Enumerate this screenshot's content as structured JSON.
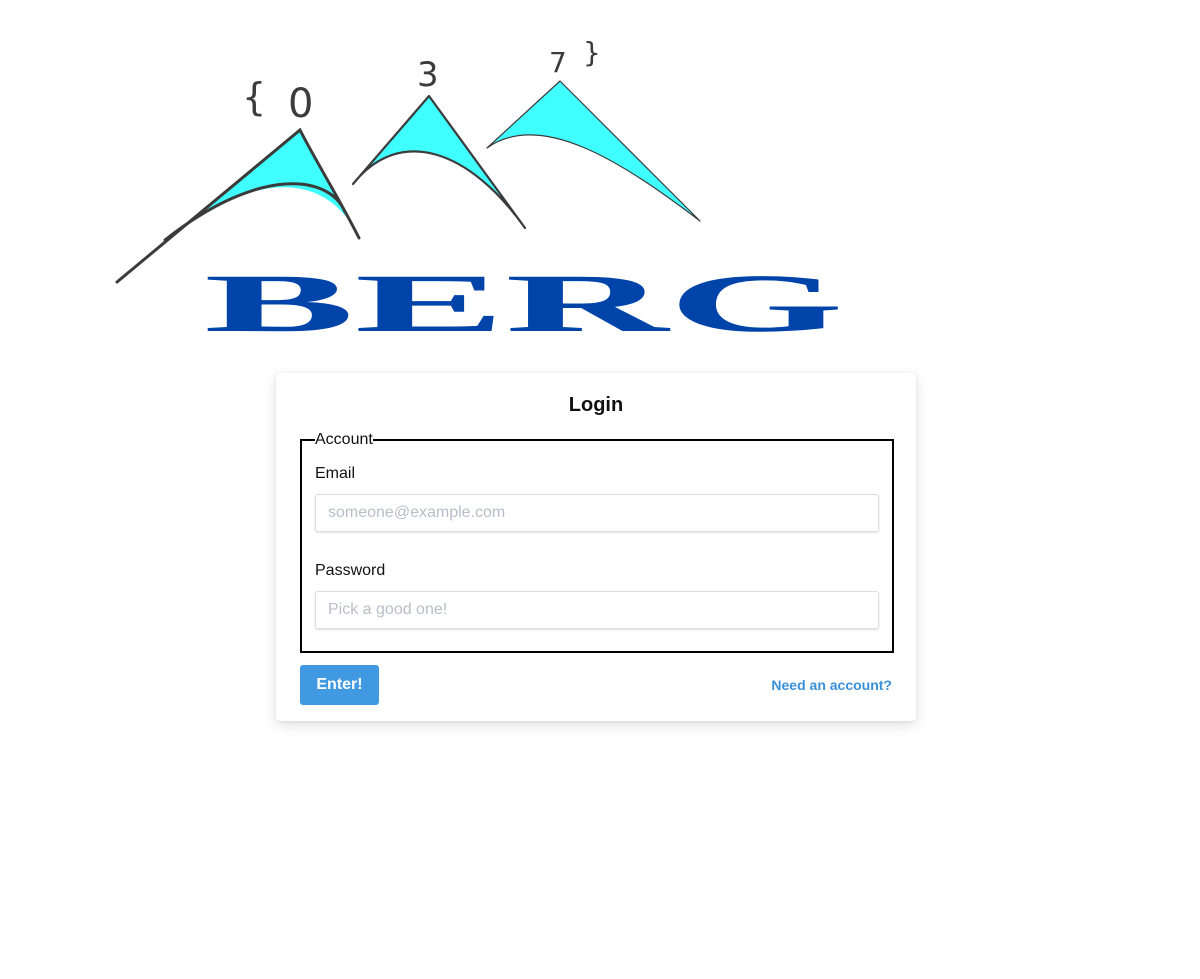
{
  "logo": {
    "brand_text": "BERG",
    "brace_open": "{",
    "brace_close": "}",
    "digits": [
      "0",
      "3",
      "7"
    ],
    "colors": {
      "peak_fill": "#40ffff",
      "peak_stroke": "#3b3b3b",
      "brand": "#0044aa"
    }
  },
  "login": {
    "title": "Login",
    "fieldset_legend": "Account",
    "email": {
      "label": "Email",
      "value": "",
      "placeholder": "someone@example.com"
    },
    "password": {
      "label": "Password",
      "value": "",
      "placeholder": "Pick a good one!"
    },
    "submit_label": "Enter!",
    "signup_link": "Need an account?"
  },
  "colors": {
    "button_bg": "#4199e1",
    "link": "#3a8fd9"
  }
}
